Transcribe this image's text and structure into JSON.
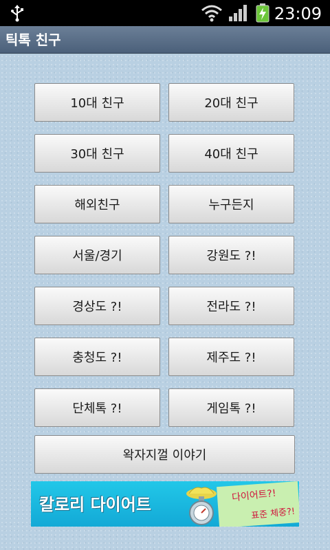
{
  "statusbar": {
    "time": "23:09",
    "icons": [
      "usb-icon",
      "wifi-icon",
      "signal-icon",
      "battery-charging-icon"
    ]
  },
  "titlebar": {
    "title": "틱톡 친구"
  },
  "buttons": {
    "teens": "10대 친구",
    "twenties": "20대 친구",
    "thirties": "30대 친구",
    "forties": "40대 친구",
    "overseas": "해외친구",
    "anyone": "누구든지",
    "seoul": "서울/경기",
    "gangwon": "강원도 ?!",
    "gyeongsang": "경상도 ?!",
    "jeolla": "전라도 ?!",
    "chungcheong": "충청도 ?!",
    "jeju": "제주도 ?!",
    "group_talk": "단체톡 ?!",
    "game_talk": "게임톡 ?!",
    "wangjaji": "왁자지껄 이야기"
  },
  "banner": {
    "headline": "칼로리 다이어트",
    "line1": "다이어트?!",
    "line2": "표준 체중?!",
    "colors": {
      "background": "#13a9d6",
      "note": "#c9efb0",
      "note_text": "#d0143c"
    }
  }
}
